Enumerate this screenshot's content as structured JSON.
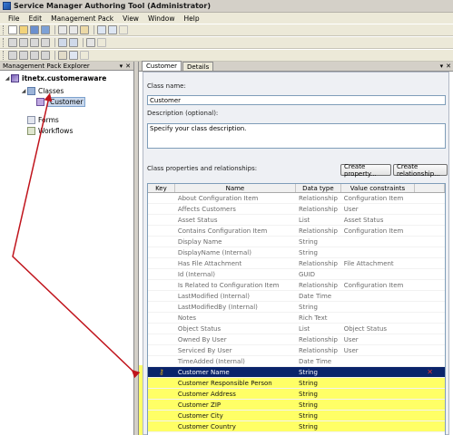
{
  "window": {
    "title": "Service Manager Authoring Tool (Administrator)"
  },
  "menu": {
    "items": [
      "File",
      "Edit",
      "Management Pack",
      "View",
      "Window",
      "Help"
    ]
  },
  "left_pane": {
    "header": "Management Pack Explorer",
    "controls": [
      "▾",
      "✕"
    ],
    "tree": {
      "pack": "itnetx.customeraware",
      "classes": "Classes",
      "customer": "Customer",
      "forms": "Forms",
      "workflows": "Workflows"
    }
  },
  "right_pane": {
    "tabs": [
      "Customer",
      "Details"
    ],
    "controls": [
      "▾",
      "✕"
    ],
    "class_name_label": "Class name:",
    "class_name_value": "Customer",
    "description_label": "Description (optional):",
    "description_value": "Specify your class description.",
    "properties_label": "Class properties and relationships:",
    "create_property_button": "Create property...",
    "create_relationship_button": "Create relationship...",
    "grid": {
      "columns": [
        "Key",
        "Name",
        "Data type",
        "Value constraints"
      ],
      "rows": [
        {
          "name": "About Configuration Item",
          "type": "Relationship",
          "value": "Configuration Item",
          "custom": false
        },
        {
          "name": "Affects Customers",
          "type": "Relationship",
          "value": "User",
          "custom": false
        },
        {
          "name": "Asset Status",
          "type": "List",
          "value": "Asset Status",
          "custom": false
        },
        {
          "name": "Contains Configuration Item",
          "type": "Relationship",
          "value": "Configuration Item",
          "custom": false
        },
        {
          "name": "Display Name",
          "type": "String",
          "value": "",
          "custom": false
        },
        {
          "name": "DisplayName (Internal)",
          "type": "String",
          "value": "",
          "custom": false
        },
        {
          "name": "Has File Attachment",
          "type": "Relationship",
          "value": "File Attachment",
          "custom": false
        },
        {
          "name": "Id (Internal)",
          "type": "GUID",
          "value": "",
          "custom": false
        },
        {
          "name": "Is Related to Configuration Item",
          "type": "Relationship",
          "value": "Configuration Item",
          "custom": false
        },
        {
          "name": "LastModified (Internal)",
          "type": "Date Time",
          "value": "",
          "custom": false
        },
        {
          "name": "LastModifiedBy (Internal)",
          "type": "String",
          "value": "",
          "custom": false
        },
        {
          "name": "Notes",
          "type": "Rich Text",
          "value": "",
          "custom": false
        },
        {
          "name": "Object Status",
          "type": "List",
          "value": "Object Status",
          "custom": false
        },
        {
          "name": "Owned By User",
          "type": "Relationship",
          "value": "User",
          "custom": false
        },
        {
          "name": "Serviced By User",
          "type": "Relationship",
          "value": "User",
          "custom": false
        },
        {
          "name": "TimeAdded (Internal)",
          "type": "Date Time",
          "value": "",
          "custom": false
        },
        {
          "name": "Customer Name",
          "type": "String",
          "value": "",
          "custom": true,
          "selected": true,
          "key": true
        },
        {
          "name": "Customer Responsible Person",
          "type": "String",
          "value": "",
          "custom": true
        },
        {
          "name": "Customer Address",
          "type": "String",
          "value": "",
          "custom": true
        },
        {
          "name": "Customer ZIP",
          "type": "String",
          "value": "",
          "custom": true
        },
        {
          "name": "Customer City",
          "type": "String",
          "value": "",
          "custom": true
        },
        {
          "name": "Customer Country",
          "type": "String",
          "value": "",
          "custom": true
        }
      ]
    }
  },
  "colors": {
    "highlight_yellow": "#ffff66",
    "selection_blue": "#0a246a",
    "annotation_red": "#c0141c"
  }
}
